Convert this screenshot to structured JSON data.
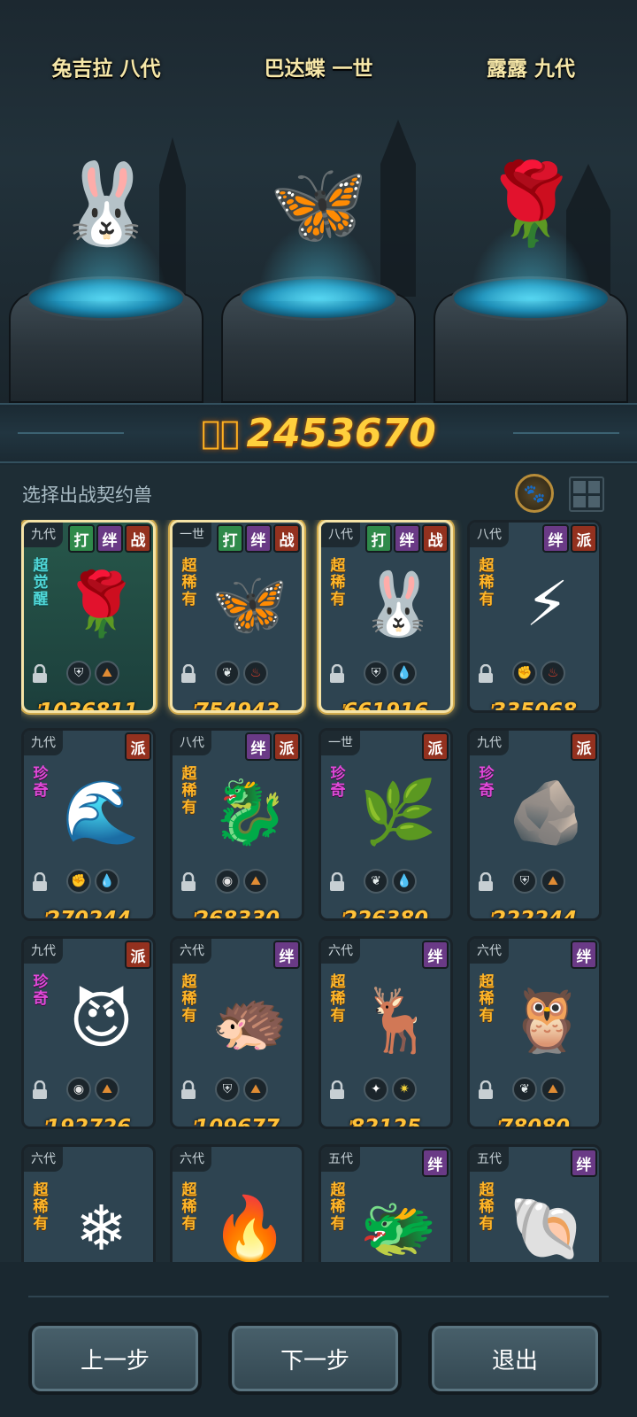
{
  "heroes": [
    {
      "name": "兔吉拉 八代",
      "glyph": "🐰"
    },
    {
      "name": "巴达蝶 一世",
      "glyph": "🦋"
    },
    {
      "name": "露露 九代",
      "glyph": "🌹"
    }
  ],
  "power": {
    "icon": "power-flame-icon",
    "value": "2453670"
  },
  "select_title": "选择出战契约兽",
  "cards": [
    {
      "gen": "九代",
      "badges": [
        "打",
        "绊",
        "战"
      ],
      "rarity": "超觉醒",
      "rarity_style": "awake",
      "glyph": "🌹",
      "attr1": "shield",
      "attr2": "earth",
      "power": "1036811",
      "selected": true,
      "featured": true
    },
    {
      "gen": "一世",
      "badges": [
        "打",
        "绊",
        "战"
      ],
      "rarity": "超稀有",
      "rarity_style": "rare",
      "glyph": "🦋",
      "attr1": "leaf",
      "attr2": "fire",
      "power": "754943",
      "selected": true,
      "featured": false
    },
    {
      "gen": "八代",
      "badges": [
        "打",
        "绊",
        "战"
      ],
      "rarity": "超稀有",
      "rarity_style": "rare",
      "glyph": "🐰",
      "attr1": "shield",
      "attr2": "water",
      "power": "661916",
      "selected": true,
      "featured": false
    },
    {
      "gen": "八代",
      "badges": [
        "绊",
        "派"
      ],
      "rarity": "超稀有",
      "rarity_style": "rare",
      "glyph": "⚡",
      "attr1": "fist",
      "attr2": "fire",
      "power": "335068",
      "selected": false,
      "featured": false
    },
    {
      "gen": "九代",
      "badges": [
        "派"
      ],
      "rarity": "珍奇",
      "rarity_style": "rare2",
      "glyph": "🌊",
      "attr1": "fist",
      "attr2": "water",
      "power": "270244",
      "selected": false,
      "featured": false
    },
    {
      "gen": "八代",
      "badges": [
        "绊",
        "派"
      ],
      "rarity": "超稀有",
      "rarity_style": "rare",
      "glyph": "🐉",
      "attr1": "eye",
      "attr2": "earth",
      "power": "268330",
      "selected": false,
      "featured": false
    },
    {
      "gen": "一世",
      "badges": [
        "派"
      ],
      "rarity": "珍奇",
      "rarity_style": "rare2",
      "glyph": "🌿",
      "attr1": "leaf",
      "attr2": "water",
      "power": "226380",
      "selected": false,
      "featured": false
    },
    {
      "gen": "九代",
      "badges": [
        "派"
      ],
      "rarity": "珍奇",
      "rarity_style": "rare2",
      "glyph": "🪨",
      "attr1": "shield",
      "attr2": "earth",
      "power": "222244",
      "selected": false,
      "featured": false
    },
    {
      "gen": "九代",
      "badges": [
        "派"
      ],
      "rarity": "珍奇",
      "rarity_style": "rare2",
      "glyph": "😈",
      "attr1": "eye",
      "attr2": "earth",
      "power": "192726",
      "selected": false,
      "featured": false
    },
    {
      "gen": "六代",
      "badges": [
        "绊"
      ],
      "rarity": "超稀有",
      "rarity_style": "rare",
      "glyph": "🦔",
      "attr1": "shield",
      "attr2": "earth",
      "power": "109677",
      "selected": false,
      "featured": false
    },
    {
      "gen": "六代",
      "badges": [
        "绊"
      ],
      "rarity": "超稀有",
      "rarity_style": "rare",
      "glyph": "🦌",
      "attr1": "star",
      "attr2": "light",
      "power": "82125",
      "selected": false,
      "featured": false
    },
    {
      "gen": "六代",
      "badges": [
        "绊"
      ],
      "rarity": "超稀有",
      "rarity_style": "rare",
      "glyph": "🦉",
      "attr1": "leaf",
      "attr2": "earth",
      "power": "78080",
      "selected": false,
      "featured": false
    },
    {
      "gen": "六代",
      "badges": [],
      "rarity": "超稀有",
      "rarity_style": "rare",
      "glyph": "❄",
      "attr1": "",
      "attr2": "",
      "power": "",
      "selected": false,
      "featured": false
    },
    {
      "gen": "六代",
      "badges": [],
      "rarity": "超稀有",
      "rarity_style": "rare",
      "glyph": "🔥",
      "attr1": "",
      "attr2": "",
      "power": "",
      "selected": false,
      "featured": false
    },
    {
      "gen": "五代",
      "badges": [
        "绊"
      ],
      "rarity": "超稀有",
      "rarity_style": "rare",
      "glyph": "🐲",
      "attr1": "",
      "attr2": "",
      "power": "",
      "selected": false,
      "featured": false
    },
    {
      "gen": "五代",
      "badges": [
        "绊"
      ],
      "rarity": "超稀有",
      "rarity_style": "rare",
      "glyph": "🐚",
      "attr1": "",
      "attr2": "",
      "power": "",
      "selected": false,
      "featured": false
    }
  ],
  "buttons": {
    "prev": "上一步",
    "next": "下一步",
    "exit": "退出"
  }
}
